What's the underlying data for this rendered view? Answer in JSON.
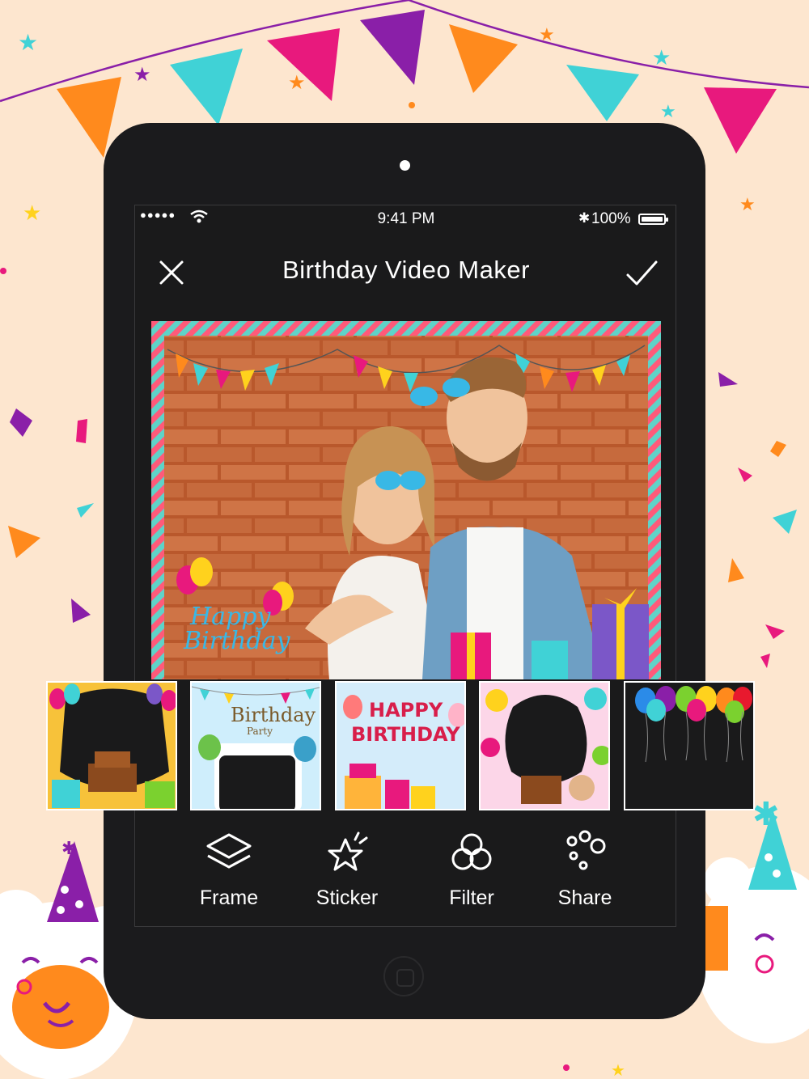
{
  "status_bar": {
    "signal": "●●●●●",
    "time": "9:41 PM",
    "bluetooth": "✱",
    "battery": "100%"
  },
  "header": {
    "title": "Birthday Video Maker",
    "close_icon": "close-icon",
    "confirm_icon": "checkmark-icon"
  },
  "editor": {
    "frame_text": [
      "Happy",
      "Birthday"
    ]
  },
  "frame_thumbnails": [
    {
      "name": "cake-balloons-frame",
      "text": ""
    },
    {
      "name": "birthday-party-frame",
      "text": [
        "Birthday",
        "Party"
      ]
    },
    {
      "name": "happy-birthday-frame",
      "text": [
        "HAPPY",
        "BIRTHDAY"
      ]
    },
    {
      "name": "candy-cake-frame",
      "text": ""
    },
    {
      "name": "balloons-frame",
      "text": ""
    }
  ],
  "toolbar": {
    "frame_label": "Frame",
    "sticker_label": "Sticker",
    "filter_label": "Filter",
    "share_label": "Share"
  },
  "colors": {
    "background": "#fde6cf",
    "device": "#1b1b1d",
    "accent_pink": "#e8197d",
    "accent_orange": "#ff8a1d",
    "accent_teal": "#40d2d6"
  }
}
